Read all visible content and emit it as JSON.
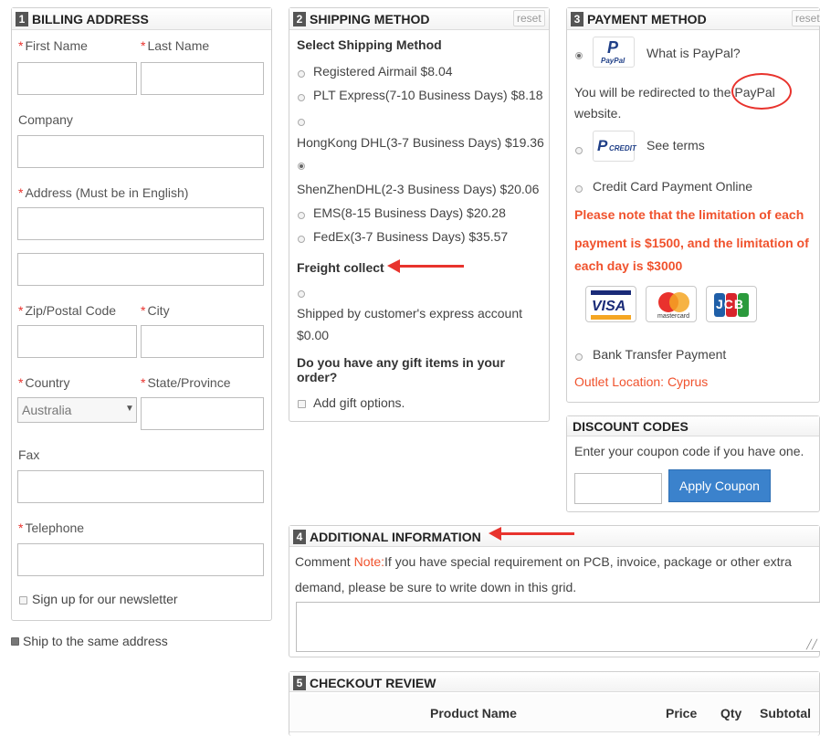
{
  "billing": {
    "num": "1",
    "title": "BILLING ADDRESS",
    "first_name": "First Name",
    "last_name": "Last Name",
    "company": "Company",
    "address": "Address (Must be in English)",
    "zip": "Zip/Postal Code",
    "city": "City",
    "country": "Country",
    "country_value": "Australia",
    "state": "State/Province",
    "fax": "Fax",
    "telephone": "Telephone",
    "newsletter": "Sign up for our newsletter",
    "same_address": "Ship to the same address",
    "required_mark": "*"
  },
  "shipping": {
    "num": "2",
    "title": "SHIPPING METHOD",
    "reset": "reset",
    "subtitle": "Select Shipping Method",
    "options": [
      "Registered Airmail $8.04",
      "PLT Express(7-10 Business Days) $8.18",
      "HongKong DHL(3-7 Business Days) $19.36",
      "ShenZhenDHL(2-3 Business Days) $20.06",
      "EMS(8-15 Business Days) $20.28",
      "FedEx(3-7 Business Days) $35.57"
    ],
    "freight_title": "Freight collect",
    "freight_line1": "Shipped by customer's express account",
    "freight_line2": "$0.00",
    "gift_q1": "Do you have any gift items in your",
    "gift_q2": "order?",
    "gift_option": "Add gift options."
  },
  "payment": {
    "num": "3",
    "title": "PAYMENT METHOD",
    "reset": "reset",
    "paypal_what": "What is PayPal?",
    "redirect_1": "You will be redirected to the ",
    "redirect_paypal": "PayPal",
    "redirect_2": "website.",
    "see_terms": "See terms",
    "credit_card": "Credit Card Payment Online",
    "limit_1": "Please note that the limitation of each",
    "limit_2": "payment is $1500, and the limitation of",
    "limit_3": "each day is $3000",
    "bank": "Bank Transfer Payment",
    "outlet": "Outlet Location: Cyprus",
    "logo_paypal": "PayPal",
    "logo_credit": "CREDIT",
    "logo_visa": "VISA",
    "logo_mc": "mastercard",
    "logo_jcb": "JCB"
  },
  "discount": {
    "title": "DISCOUNT CODES",
    "hint": "Enter your coupon code if you have one.",
    "apply": "Apply Coupon"
  },
  "additional": {
    "num": "4",
    "title": "ADDITIONAL INFORMATION",
    "comment": "Comment",
    "note_label": "Note:",
    "note_1": "If you have special requirement on PCB, invoice, package or other extra",
    "note_2": "demand, please be sure to write down in this grid."
  },
  "review": {
    "num": "5",
    "title": "CHECKOUT REVIEW",
    "columns": [
      "Product Name",
      "Price",
      "Qty",
      "Subtotal"
    ]
  },
  "colors": {
    "required": "#e9322d",
    "warning": "#f0522d",
    "button": "#3b82cc",
    "annotation": "#e8332d"
  }
}
